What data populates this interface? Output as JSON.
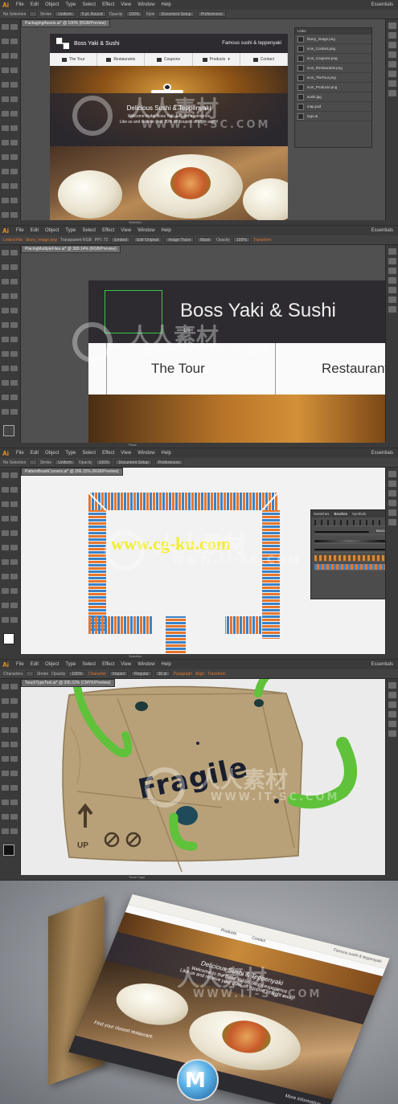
{
  "menu": {
    "app": "Ai",
    "items": [
      "File",
      "Edit",
      "Object",
      "Type",
      "Select",
      "Effect",
      "View",
      "Window",
      "Help"
    ],
    "workspace": "Essentials"
  },
  "panel1": {
    "selection_label": "No Selection",
    "stroke_label": "Stroke",
    "uniform": "Uniform",
    "brush": "5 pt. Round",
    "opacity_label": "Opacity",
    "opacity": "100%",
    "style_label": "Style",
    "document_setup": "Document Setup",
    "preferences": "Preferences",
    "doc_tab": "PackagingAssets.ai* @ 100% (RGB/Preview)",
    "status": "Selection",
    "site": {
      "brand": "Boss Yaki & Sushi",
      "tagline": "Famous sushi & teppenyaki",
      "nav": [
        "The Tour",
        "Restaurants",
        "Coupons",
        "Products",
        "Contact"
      ],
      "hero_title": "Delicious Sushi & Teppenyaki",
      "hero_line1": "Welcome to the Boss Yaki & Sushi experience",
      "hero_line2": "Like us and receive your 20% off coupon straight away!"
    },
    "links_panel": {
      "title": "Links",
      "files": [
        "blurry_image.png",
        "icon_Contact.png",
        "icon_Coupons.png",
        "icon_Restaurants.png",
        "icon_TheTour.png",
        "icon_Products.png",
        "sushi.jpg",
        "map.psd",
        "logo.ai"
      ]
    }
  },
  "panel2": {
    "ctrl": [
      "Linked File",
      "blurry_image.png",
      "Transparent RGB",
      "PPI: 72",
      "Embed",
      "Edit Original",
      "Image Trace",
      "Mask",
      "Opacity",
      "100%",
      "Transform"
    ],
    "doc_tab": "PlacingMultipleFiles.ai* @ 389.14% (RGB/Preview)",
    "brand": "Boss Yaki & Sushi",
    "counter": "1/3",
    "nav": [
      "The Tour",
      "Restaurant"
    ],
    "status": "Place"
  },
  "panel3": {
    "doc_tab": "PatternBrushCorners.ai* @ 286.15% (RGB/Preview)",
    "tabs": [
      "Swatches",
      "Brushes",
      "Symbols"
    ],
    "basic": "Basic",
    "status": "Selection"
  },
  "panel4": {
    "ctrl": [
      "Characters",
      "Stroke",
      "Opacity",
      "100%",
      "Character",
      "Impact",
      "Regular",
      "36 pt",
      "Paragraph",
      "Align",
      "Transform"
    ],
    "doc_tab": "TouchTypeTool.ai* @ 395.33% (CMYK/Preview)",
    "fragile": "Fragile",
    "up": "UP",
    "status": "Touch Type"
  },
  "panel5": {
    "brochure_top": "Famous sushi & teppenyaki",
    "nav": [
      "Products",
      "Contact"
    ],
    "hero_title": "Delicious Sushi & Teppenyaki",
    "hero_line1": "Welcome to the Boss Yaki & Sushi experience",
    "hero_line2": "Like us and receive your 20% off coupon straight away!",
    "find": "Find your closest restaurant.",
    "more": "More information"
  },
  "watermarks": {
    "cn": "人人素材",
    "site": "WWW.IT-SC.COM",
    "cgku": "www.cg-ku.com"
  },
  "colors": {
    "ui_dark": "#3a3a3a",
    "canvas": "#505050",
    "accent_orange": "#e5762d",
    "accent_blue": "#3b83c7",
    "brand_dark": "#2d2b30",
    "selection_green": "#3ac44a"
  }
}
